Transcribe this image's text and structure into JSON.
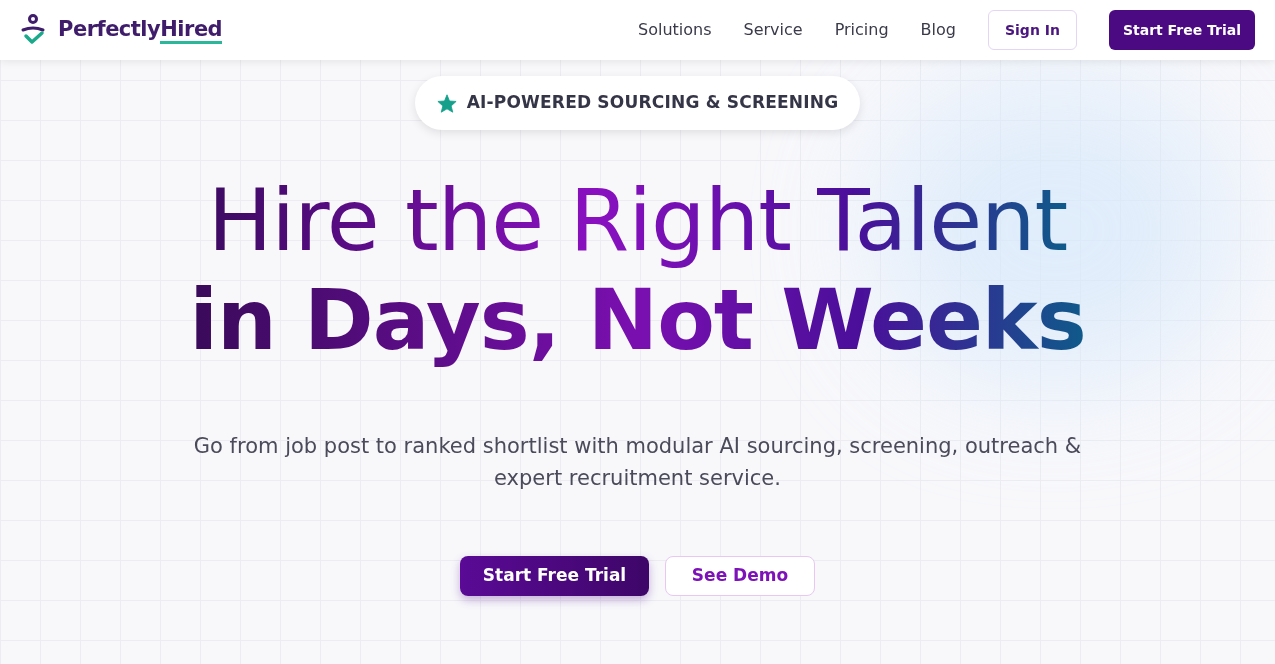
{
  "logo": {
    "prefix": "Perfectly",
    "accent": "Hired"
  },
  "nav": {
    "links": [
      "Solutions",
      "Service",
      "Pricing",
      "Blog"
    ],
    "sign_in": "Sign In",
    "cta": "Start Free Trial"
  },
  "hero": {
    "badge": "AI-POWERED SOURCING & SCREENING",
    "headline_1": "Hire the Right Talent",
    "headline_2": "in Days, Not Weeks",
    "subtitle": "Go from job post to ranked shortlist with modular AI sourcing, screening, outreach & expert recruitment service.",
    "primary": "Start Free Trial",
    "secondary": "See Demo"
  }
}
